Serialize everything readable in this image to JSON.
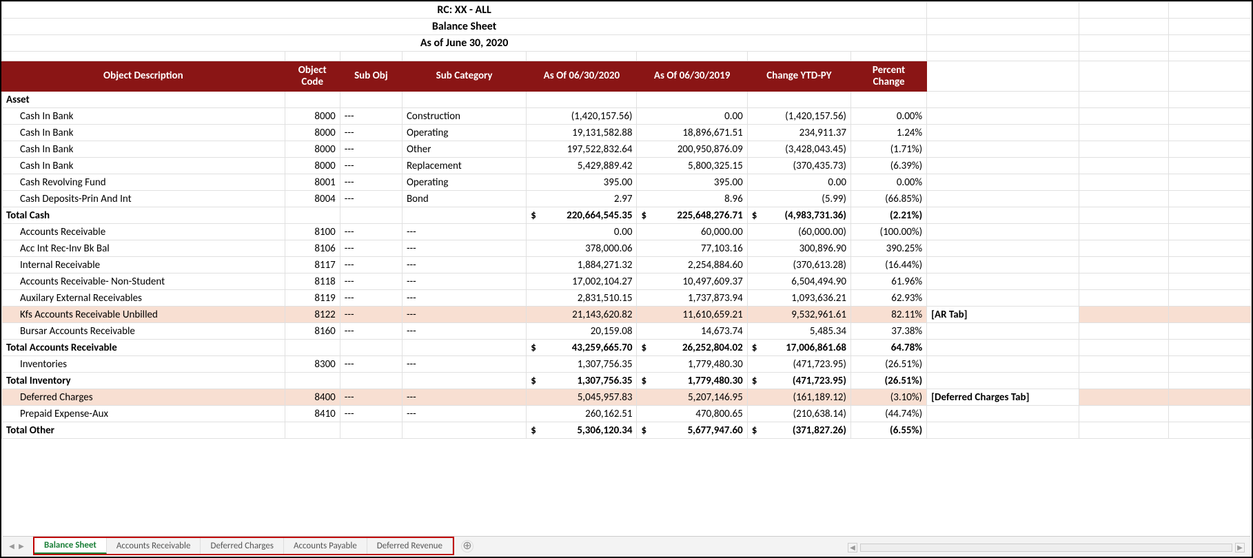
{
  "title": {
    "line1": "RC: XX -  ALL",
    "line2": "Balance Sheet",
    "line3": "As of June 30, 2020"
  },
  "headers": {
    "desc": "Object Description",
    "code1": "Object",
    "code2": "Code",
    "sub": "Sub Obj",
    "cat": "Sub Category",
    "v1": "As Of 06/30/2020",
    "v2": "As Of 06/30/2019",
    "chg": "Change YTD-PY",
    "pct1": "Percent",
    "pct2": "Change"
  },
  "section": {
    "asset": "Asset"
  },
  "rows": [
    {
      "type": "detail",
      "desc": "Cash In Bank",
      "code": "8000",
      "sub": "---",
      "cat": "Construction",
      "v1": "(1,420,157.56)",
      "v2": "0.00",
      "chg": "(1,420,157.56)",
      "pct": "0.00%"
    },
    {
      "type": "detail",
      "desc": "Cash In Bank",
      "code": "8000",
      "sub": "---",
      "cat": "Operating",
      "v1": "19,131,582.88",
      "v2": "18,896,671.51",
      "chg": "234,911.37",
      "pct": "1.24%"
    },
    {
      "type": "detail",
      "desc": "Cash In Bank",
      "code": "8000",
      "sub": "---",
      "cat": "Other",
      "v1": "197,522,832.64",
      "v2": "200,950,876.09",
      "chg": "(3,428,043.45)",
      "pct": "(1.71%)"
    },
    {
      "type": "detail",
      "desc": "Cash In Bank",
      "code": "8000",
      "sub": "---",
      "cat": "Replacement",
      "v1": "5,429,889.42",
      "v2": "5,800,325.15",
      "chg": "(370,435.73)",
      "pct": "(6.39%)"
    },
    {
      "type": "detail",
      "desc": "Cash Revolving Fund",
      "code": "8001",
      "sub": "---",
      "cat": "Operating",
      "v1": "395.00",
      "v2": "395.00",
      "chg": "0.00",
      "pct": "0.00%"
    },
    {
      "type": "detail",
      "desc": "Cash Deposits-Prin And Int",
      "code": "8004",
      "sub": "---",
      "cat": "Bond",
      "v1": "2.97",
      "v2": "8.96",
      "chg": "(5.99)",
      "pct": "(66.85%)"
    },
    {
      "type": "total",
      "desc": "Total Cash",
      "v1p": "$",
      "v1": "220,664,545.35",
      "v2p": "$",
      "v2": "225,648,276.71",
      "chgp": "$",
      "chg": "(4,983,731.36)",
      "pct": "(2.21%)"
    },
    {
      "type": "detail",
      "desc": "Accounts Receivable",
      "code": "8100",
      "sub": "---",
      "cat": "---",
      "v1": "0.00",
      "v2": "60,000.00",
      "chg": "(60,000.00)",
      "pct": "(100.00%)"
    },
    {
      "type": "detail",
      "desc": "Acc Int Rec-Inv Bk Bal",
      "code": "8106",
      "sub": "---",
      "cat": "---",
      "v1": "378,000.06",
      "v2": "77,103.16",
      "chg": "300,896.90",
      "pct": "390.25%"
    },
    {
      "type": "detail",
      "desc": "Internal Receivable",
      "code": "8117",
      "sub": "---",
      "cat": "---",
      "v1": "1,884,271.32",
      "v2": "2,254,884.60",
      "chg": "(370,613.28)",
      "pct": "(16.44%)"
    },
    {
      "type": "detail",
      "desc": "Accounts Receivable- Non-Student",
      "code": "8118",
      "sub": "---",
      "cat": "---",
      "v1": "17,002,104.27",
      "v2": "10,497,609.37",
      "chg": "6,504,494.90",
      "pct": "61.96%"
    },
    {
      "type": "detail",
      "desc": "Auxilary External Receivables",
      "code": "8119",
      "sub": "---",
      "cat": "---",
      "v1": "2,831,510.15",
      "v2": "1,737,873.94",
      "chg": "1,093,636.21",
      "pct": "62.93%"
    },
    {
      "type": "detail",
      "hl": true,
      "desc": "Kfs Accounts Receivable Unbilled",
      "code": "8122",
      "sub": "---",
      "cat": "---",
      "v1": "21,143,620.82",
      "v2": "11,610,659.21",
      "chg": "9,532,961.61",
      "pct": "82.11%",
      "annot": "[AR Tab]"
    },
    {
      "type": "detail",
      "desc": "Bursar Accounts Receivable",
      "code": "8160",
      "sub": "---",
      "cat": "---",
      "v1": "20,159.08",
      "v2": "14,673.74",
      "chg": "5,485.34",
      "pct": "37.38%"
    },
    {
      "type": "total",
      "desc": "Total Accounts Receivable",
      "v1p": "$",
      "v1": "43,259,665.70",
      "v2p": "$",
      "v2": "26,252,804.02",
      "chgp": "$",
      "chg": "17,006,861.68",
      "pct": "64.78%"
    },
    {
      "type": "detail",
      "desc": "Inventories",
      "code": "8300",
      "sub": "---",
      "cat": "---",
      "v1": "1,307,756.35",
      "v2": "1,779,480.30",
      "chg": "(471,723.95)",
      "pct": "(26.51%)"
    },
    {
      "type": "total",
      "desc": "Total Inventory",
      "v1p": "$",
      "v1": "1,307,756.35",
      "v2p": "$",
      "v2": "1,779,480.30",
      "chgp": "$",
      "chg": "(471,723.95)",
      "pct": "(26.51%)"
    },
    {
      "type": "detail",
      "hl": true,
      "desc": "Deferred Charges",
      "code": "8400",
      "sub": "---",
      "cat": "---",
      "v1": "5,045,957.83",
      "v2": "5,207,146.95",
      "chg": "(161,189.12)",
      "pct": "(3.10%)",
      "annot": "[Deferred Charges Tab]"
    },
    {
      "type": "detail",
      "desc": "Prepaid Expense-Aux",
      "code": "8410",
      "sub": "---",
      "cat": "---",
      "v1": "260,162.51",
      "v2": "470,800.65",
      "chg": "(210,638.14)",
      "pct": "(44.74%)"
    },
    {
      "type": "total",
      "desc": "Total Other",
      "v1p": "$",
      "v1": "5,306,120.34",
      "v2p": "$",
      "v2": "5,677,947.60",
      "chgp": "$",
      "chg": "(371,827.26)",
      "pct": "(6.55%)"
    }
  ],
  "tabs": {
    "items": [
      {
        "label": "Balance Sheet",
        "active": true
      },
      {
        "label": "Accounts Receivable"
      },
      {
        "label": "Deferred Charges"
      },
      {
        "label": "Accounts Payable"
      },
      {
        "label": "Deferred Revenue"
      }
    ],
    "new": "⊕",
    "nav_prev": "◀",
    "nav_next": "▶"
  }
}
